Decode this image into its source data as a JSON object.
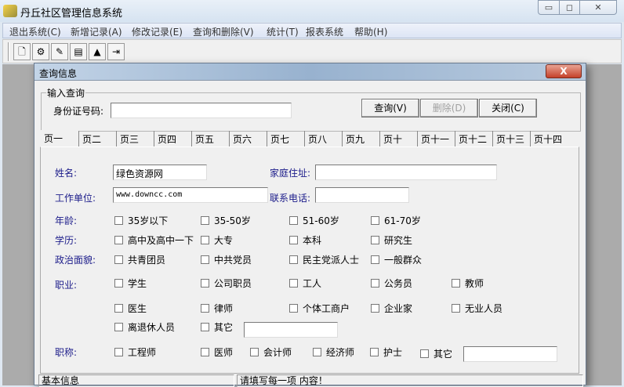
{
  "app": {
    "title": "丹丘社区管理信息系统",
    "minimize": "▭",
    "maximize": "◻",
    "close": "✕"
  },
  "menu": [
    "退出系统(C)",
    "新增记录(A)",
    "修改记录(E)",
    "查询和删除(V)",
    "统计(T)",
    "报表系统",
    "帮助(H)"
  ],
  "toolbar": [
    {
      "icon": "new-file-icon",
      "glyph": "🗋"
    },
    {
      "icon": "tools-icon",
      "glyph": "⚙"
    },
    {
      "icon": "edit-record-icon",
      "glyph": "✎"
    },
    {
      "icon": "database-icon",
      "glyph": "▤"
    },
    {
      "icon": "report-icon",
      "glyph": "▲"
    },
    {
      "icon": "exit-icon",
      "glyph": "⇥"
    }
  ],
  "dialog": {
    "title": "查询信息",
    "close": "X",
    "query_group": "输入查询",
    "id_label": "身份证号码:",
    "id_value": "",
    "buttons": {
      "query": "查询(V)",
      "delete": "删除(D)",
      "close": "关闭(C)"
    },
    "tabs": [
      "页一",
      "页二",
      "页三",
      "页四",
      "页五",
      "页六",
      "页七",
      "页八",
      "页九",
      "页十",
      "页十一",
      "页十二",
      "页十三",
      "页十四"
    ],
    "form": {
      "name_label": "姓名:",
      "name_value": "绿色资源网",
      "address_label": "家庭住址:",
      "address_value": "",
      "work_label": "工作单位:",
      "work_value": "www.downcc.com",
      "phone_label": "联系电话:",
      "phone_value": ""
    },
    "groups": {
      "age": {
        "label": "年龄:",
        "options": [
          "35岁以下",
          "35-50岁",
          "51-60岁",
          "61-70岁"
        ]
      },
      "edu": {
        "label": "学历:",
        "options": [
          "高中及高中一下",
          "大专",
          "本科",
          "研究生"
        ]
      },
      "politics": {
        "label": "政治面貌:",
        "options": [
          "共青团员",
          "中共党员",
          "民主党派人士",
          "一般群众"
        ]
      },
      "job": {
        "label": "职业:",
        "options": [
          "学生",
          "公司职员",
          "工人",
          "公务员",
          "教师",
          "医生",
          "律师",
          "个体工商户",
          "企业家",
          "无业人员",
          "离退休人员",
          "其它"
        ],
        "other_value": ""
      },
      "title": {
        "label": "职称:",
        "options": [
          "工程师",
          "医师",
          "会计师",
          "经济师",
          "护士",
          "其它"
        ],
        "other_value": ""
      }
    },
    "status": [
      "基本信息",
      "请填写每一项 内容！"
    ]
  }
}
